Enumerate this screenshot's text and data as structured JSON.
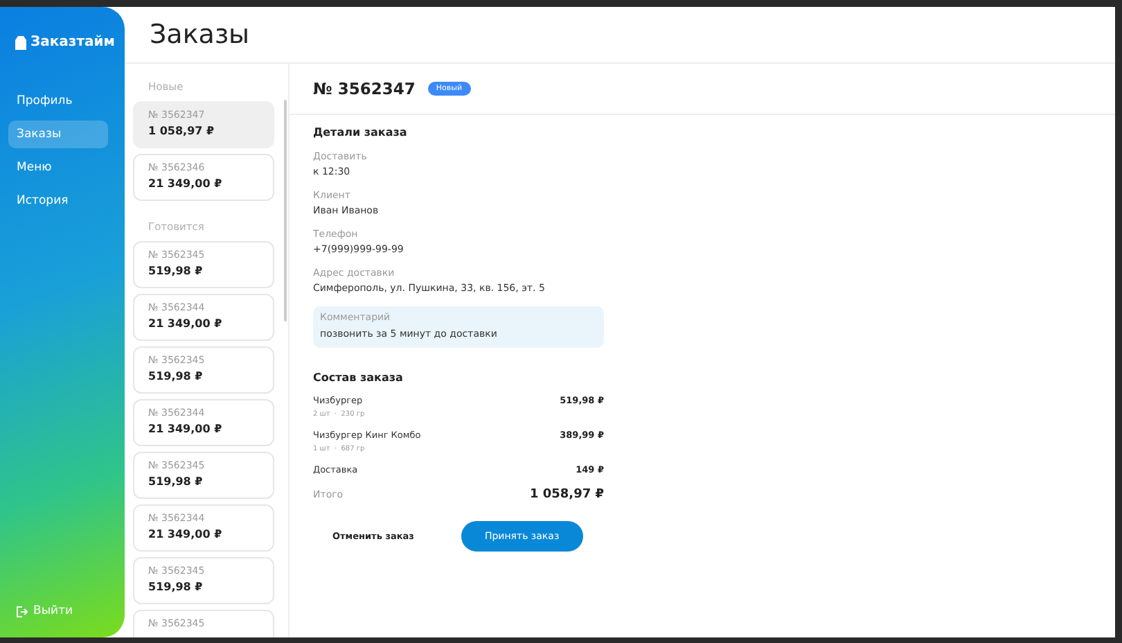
{
  "sidebar": {
    "logo": "Заказтайм",
    "items": [
      {
        "label": "Профиль",
        "selected": false
      },
      {
        "label": "Заказы",
        "selected": true
      },
      {
        "label": "Меню",
        "selected": false
      },
      {
        "label": "История",
        "selected": false
      }
    ],
    "logout": "Выйти"
  },
  "page_title": "Заказы",
  "order_groups": [
    {
      "title": "Новые",
      "orders": [
        {
          "number": "№ 3562347",
          "amount": "1 058,97 ₽",
          "selected": true
        },
        {
          "number": "№ 3562346",
          "amount": "21 349,00 ₽",
          "selected": false
        }
      ]
    },
    {
      "title": "Готовится",
      "orders": [
        {
          "number": "№ 3562345",
          "amount": "519,98 ₽",
          "selected": false
        },
        {
          "number": "№ 3562344",
          "amount": "21 349,00 ₽",
          "selected": false
        },
        {
          "number": "№ 3562345",
          "amount": "519,98 ₽",
          "selected": false
        },
        {
          "number": "№ 3562344",
          "amount": "21 349,00 ₽",
          "selected": false
        },
        {
          "number": "№ 3562345",
          "amount": "519,98 ₽",
          "selected": false
        },
        {
          "number": "№ 3562344",
          "amount": "21 349,00 ₽",
          "selected": false
        },
        {
          "number": "№ 3562345",
          "amount": "519,98 ₽",
          "selected": false
        },
        {
          "number": "№ 3562345",
          "selected": false
        }
      ]
    }
  ],
  "order": {
    "number": "№ 3562347",
    "status": "Новый",
    "details_title": "Детали заказа",
    "fields": [
      {
        "label": "Доставить",
        "value": "к 12:30"
      },
      {
        "label": "Клиент",
        "value": "Иван Иванов"
      },
      {
        "label": "Телефон",
        "value": "+7(999)999-99-99"
      },
      {
        "label": "Адрес доставки",
        "value": "Симферополь, ул. Пушкина, 33, кв. 156, эт. 5"
      }
    ],
    "comment": {
      "label": "Комментарий",
      "value": "позвонить за 5 минут до доставки"
    },
    "items_title": "Состав заказа",
    "items": [
      {
        "name": "Чизбургер",
        "meta": "2 шт  ·  230 гр",
        "price": "519,98 ₽"
      },
      {
        "name": "Чизбургер Кинг Комбо",
        "meta": "1 шт  ·  687 гр",
        "price": "389,99 ₽"
      }
    ],
    "delivery": {
      "label": "Доставка",
      "value": "149 ₽"
    },
    "total": {
      "label": "Итого",
      "value": "1 058,97 ₽"
    },
    "buttons": {
      "cancel": "Отменить заказ",
      "accept": "Принять заказ"
    }
  }
}
